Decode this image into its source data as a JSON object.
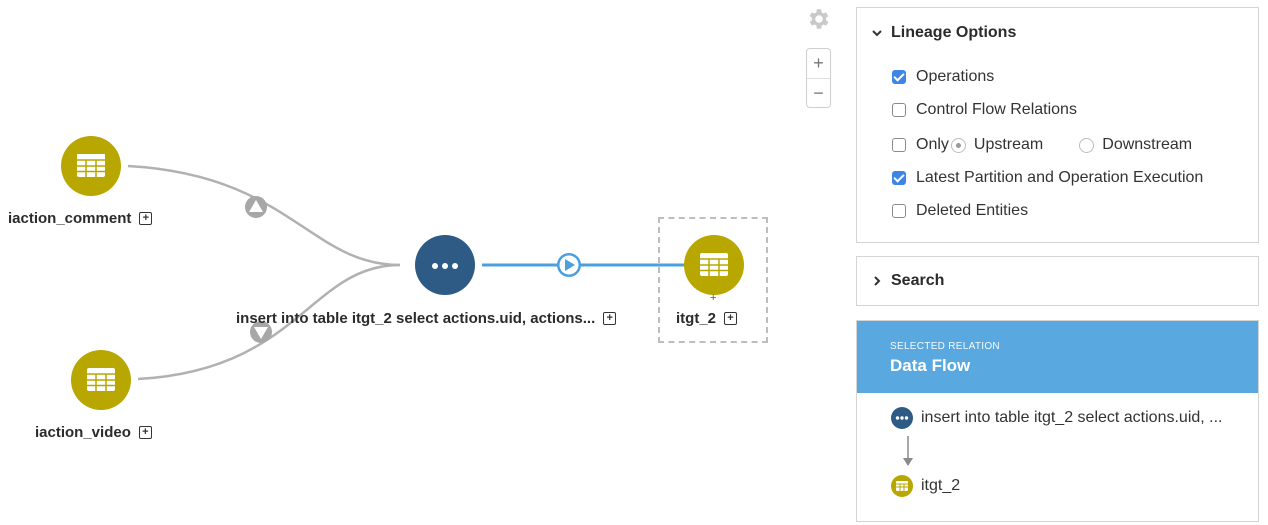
{
  "graph": {
    "nodes": {
      "comment": {
        "label": "iaction_comment"
      },
      "video": {
        "label": "iaction_video"
      },
      "process": {
        "label": "insert into table itgt_2 select actions.uid, actions..."
      },
      "target": {
        "label": "itgt_2"
      }
    },
    "tiny_plus": "+",
    "colors": {
      "table_node": "#b8a700",
      "process_node": "#2e5b85",
      "selected_edge": "#4a9fdf",
      "edge": "#b1b1b1"
    }
  },
  "controls": {
    "zoom_in": "+",
    "zoom_out": "−",
    "gear_icon": "gear-icon"
  },
  "lineage_options": {
    "title": "Lineage Options",
    "operations": {
      "label": "Operations",
      "checked": true
    },
    "control_flow": {
      "label": "Control Flow Relations",
      "checked": false
    },
    "only": {
      "label": "Only",
      "checked": false
    },
    "upstream": {
      "label": "Upstream",
      "selected": true
    },
    "downstream": {
      "label": "Downstream",
      "selected": false
    },
    "latest_partition": {
      "label": "Latest Partition and Operation Execution",
      "checked": true
    },
    "deleted_entities": {
      "label": "Deleted Entities",
      "checked": false
    }
  },
  "search": {
    "title": "Search"
  },
  "selected_relation": {
    "caption": "SELECTED RELATION",
    "title": "Data Flow",
    "source_label": "insert into table itgt_2 select actions.uid, ...",
    "target_label": "itgt_2",
    "header_color": "#59a8e0"
  }
}
